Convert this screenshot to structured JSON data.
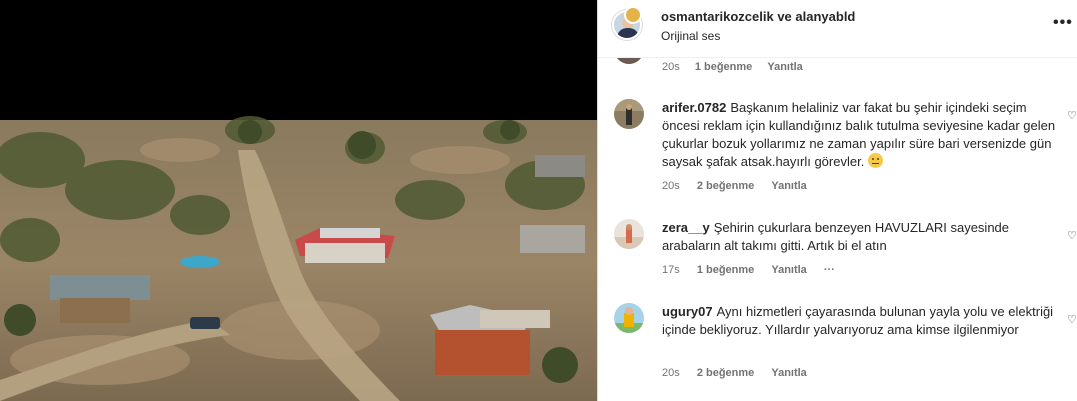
{
  "header": {
    "username": "osmantarikozcelik ve alanyabld",
    "audio": "Orijinal ses",
    "more_icon": "more-horizontal-icon"
  },
  "partial_comment": {
    "time": "20s",
    "likes": "1 beğenme",
    "reply": "Yanıtla"
  },
  "comments": [
    {
      "username": "arifer.0782",
      "text": "Başkanım helaliniz var fakat bu şehir içindeki seçim öncesi reklam için kullandığınız balık tutulma seviyesine kadar gelen çukurlar bozuk yollarımız ne zaman yapılır süre bari versenizde gün saysak şafak atsak.hayırlı görevler.",
      "emoji": "neutral-face-emoji",
      "time": "20s",
      "likes": "2 beğenme",
      "reply": "Yanıtla"
    },
    {
      "username": "zera__y",
      "text": "Şehirin çukurlara benzeyen HAVUZLARI sayesinde arabaların alt takımı gitti. Artık bi el atın",
      "time": "17s",
      "likes": "1 beğenme",
      "reply": "Yanıtla",
      "options": "···"
    },
    {
      "username": "ugury07",
      "text": "Aynı hizmetleri çayarasında bulunan yayla yolu ve elektriği içinde bekliyoruz. Yıllardır yalvarıyoruz ama kimse ilgilenmiyor",
      "time": "20s",
      "likes": "2 beğenme",
      "reply": "Yanıtla"
    }
  ],
  "colors": {
    "text": "#262626",
    "meta": "#737373",
    "divider": "#dbdbdb"
  }
}
